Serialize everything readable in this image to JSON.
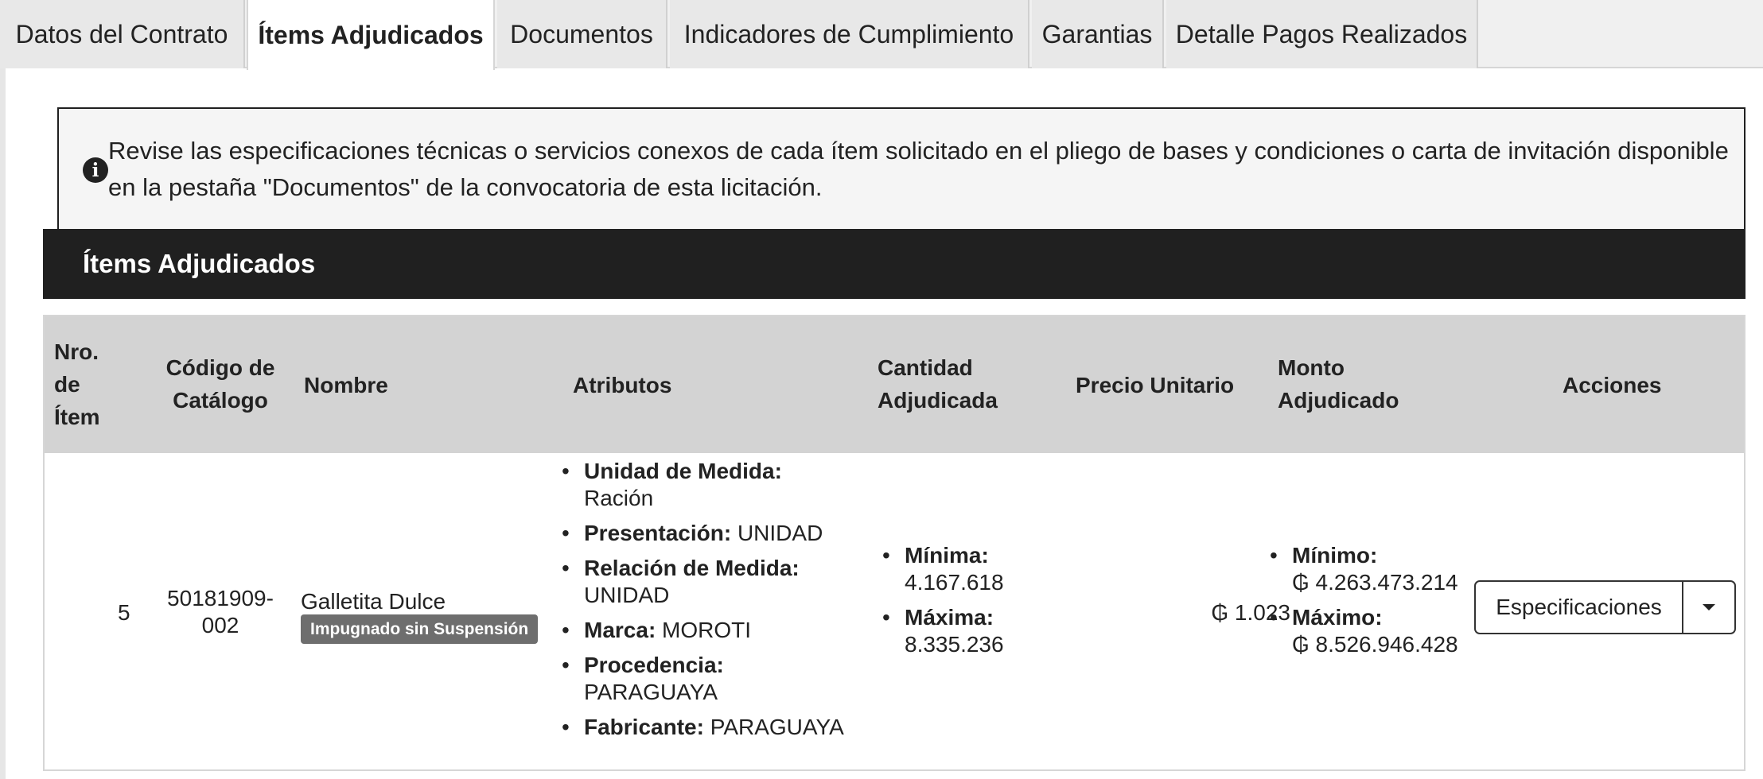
{
  "tabs": [
    {
      "label": "Datos del Contrato"
    },
    {
      "label": "Ítems Adjudicados"
    },
    {
      "label": "Documentos"
    },
    {
      "label": "Indicadores de Cumplimiento"
    },
    {
      "label": "Garantias"
    },
    {
      "label": "Detalle Pagos Realizados"
    }
  ],
  "alert": {
    "icon": "info-icon",
    "text": "Revise las especificaciones técnicas o servicios conexos de cada ítem solicitado en el pliego de bases y condiciones o carta de invitación disponible en la pestaña \"Documentos\" de la convocatoria de esta licitación."
  },
  "section": {
    "title": "Ítems Adjudicados"
  },
  "table": {
    "headers": {
      "nro": [
        "Nro.",
        "de",
        "Ítem"
      ],
      "codigo": [
        "Código de",
        "Catálogo"
      ],
      "nombre": "Nombre",
      "atributos": "Atributos",
      "cantidad": [
        "Cantidad",
        "Adjudicada"
      ],
      "precio": "Precio Unitario",
      "monto": [
        "Monto",
        "Adjudicado"
      ],
      "acciones": "Acciones"
    },
    "rows": [
      {
        "nro": "5",
        "codigo": [
          "50181909-",
          "002"
        ],
        "nombre": "Galletita Dulce",
        "badge": "Impugnado sin Suspensión",
        "atributos": [
          {
            "label": "Unidad de Medida:",
            "value": "Ración"
          },
          {
            "label": "Presentación:",
            "value": "UNIDAD"
          },
          {
            "label": "Relación de Medida:",
            "value": "UNIDAD"
          },
          {
            "label": "Marca:",
            "value": "MOROTI"
          },
          {
            "label": "Procedencia:",
            "value": "PARAGUAYA"
          },
          {
            "label": "Fabricante:",
            "value": "PARAGUAYA"
          }
        ],
        "cantidad": [
          {
            "label": "Mínima:",
            "value": "4.167.618"
          },
          {
            "label": "Máxima:",
            "value": "8.335.236"
          }
        ],
        "precio": "₲ 1.023",
        "monto": [
          {
            "label": "Mínimo:",
            "value": "₲ 4.263.473.214"
          },
          {
            "label": "Máximo:",
            "value": "₲ 8.526.946.428"
          }
        ],
        "action_label": "Especificaciones"
      }
    ]
  }
}
